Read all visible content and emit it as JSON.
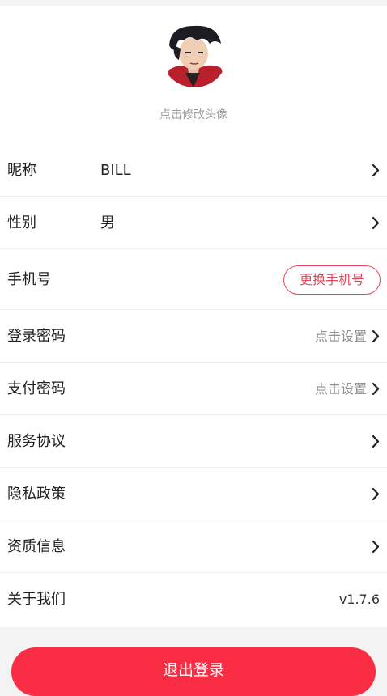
{
  "profile": {
    "avatar_hint": "点击修改头像"
  },
  "rows": [
    {
      "label": "昵称",
      "value": "BILL"
    },
    {
      "label": "性别",
      "value": "男"
    },
    {
      "label": "手机号",
      "action": "更换手机号"
    },
    {
      "label": "登录密码",
      "hint": "点击设置"
    },
    {
      "label": "支付密码",
      "hint": "点击设置"
    },
    {
      "label": "服务协议"
    },
    {
      "label": "隐私政策"
    },
    {
      "label": "资质信息"
    },
    {
      "label": "关于我们",
      "version": "v1.7.6"
    }
  ],
  "logout_label": "退出登录",
  "colors": {
    "accent": "#fb2d44",
    "pill_border": "#e5475a",
    "page_background": "#f3f3f3"
  }
}
